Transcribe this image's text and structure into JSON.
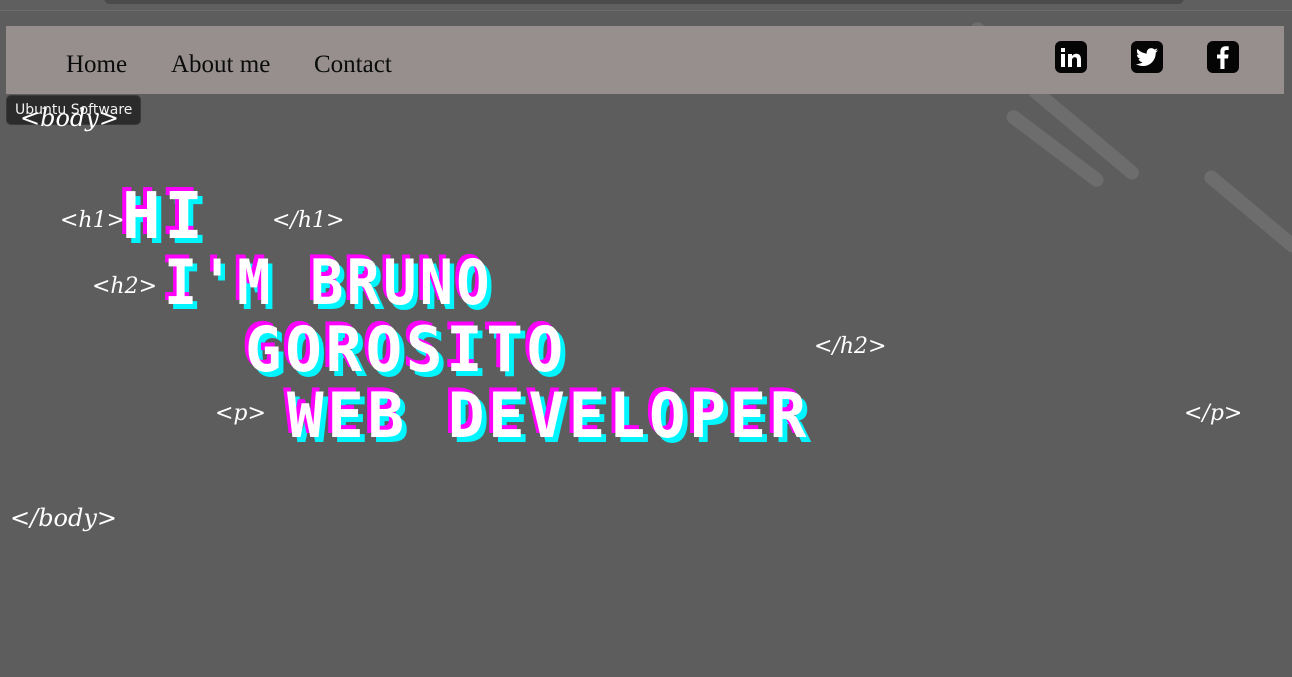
{
  "nav": {
    "links": [
      "Home",
      "About me",
      "Contact"
    ],
    "social": [
      "linkedin-icon",
      "twitter-icon",
      "facebook-icon"
    ]
  },
  "tooltip": {
    "text": "Ubuntu Software"
  },
  "tags": {
    "body_open": "<body>",
    "h1_open": "<h1>",
    "h1_close": "</h1>",
    "h2_open": "<h2>",
    "h2_close": "</h2>",
    "p_open": "<p>",
    "p_close": "</p>",
    "body_close": "</body>"
  },
  "hero": {
    "hi": "HI",
    "name_line1": "I'M BRUNO",
    "name_line2": "GOROSITO",
    "role": "WEB DEVELOPER"
  },
  "colors": {
    "background": "#5d5d5d",
    "navbar": "#968f8e",
    "glitch_magenta": "#ff00ff",
    "glitch_cyan": "#00f5ff",
    "text": "#ffffff"
  }
}
